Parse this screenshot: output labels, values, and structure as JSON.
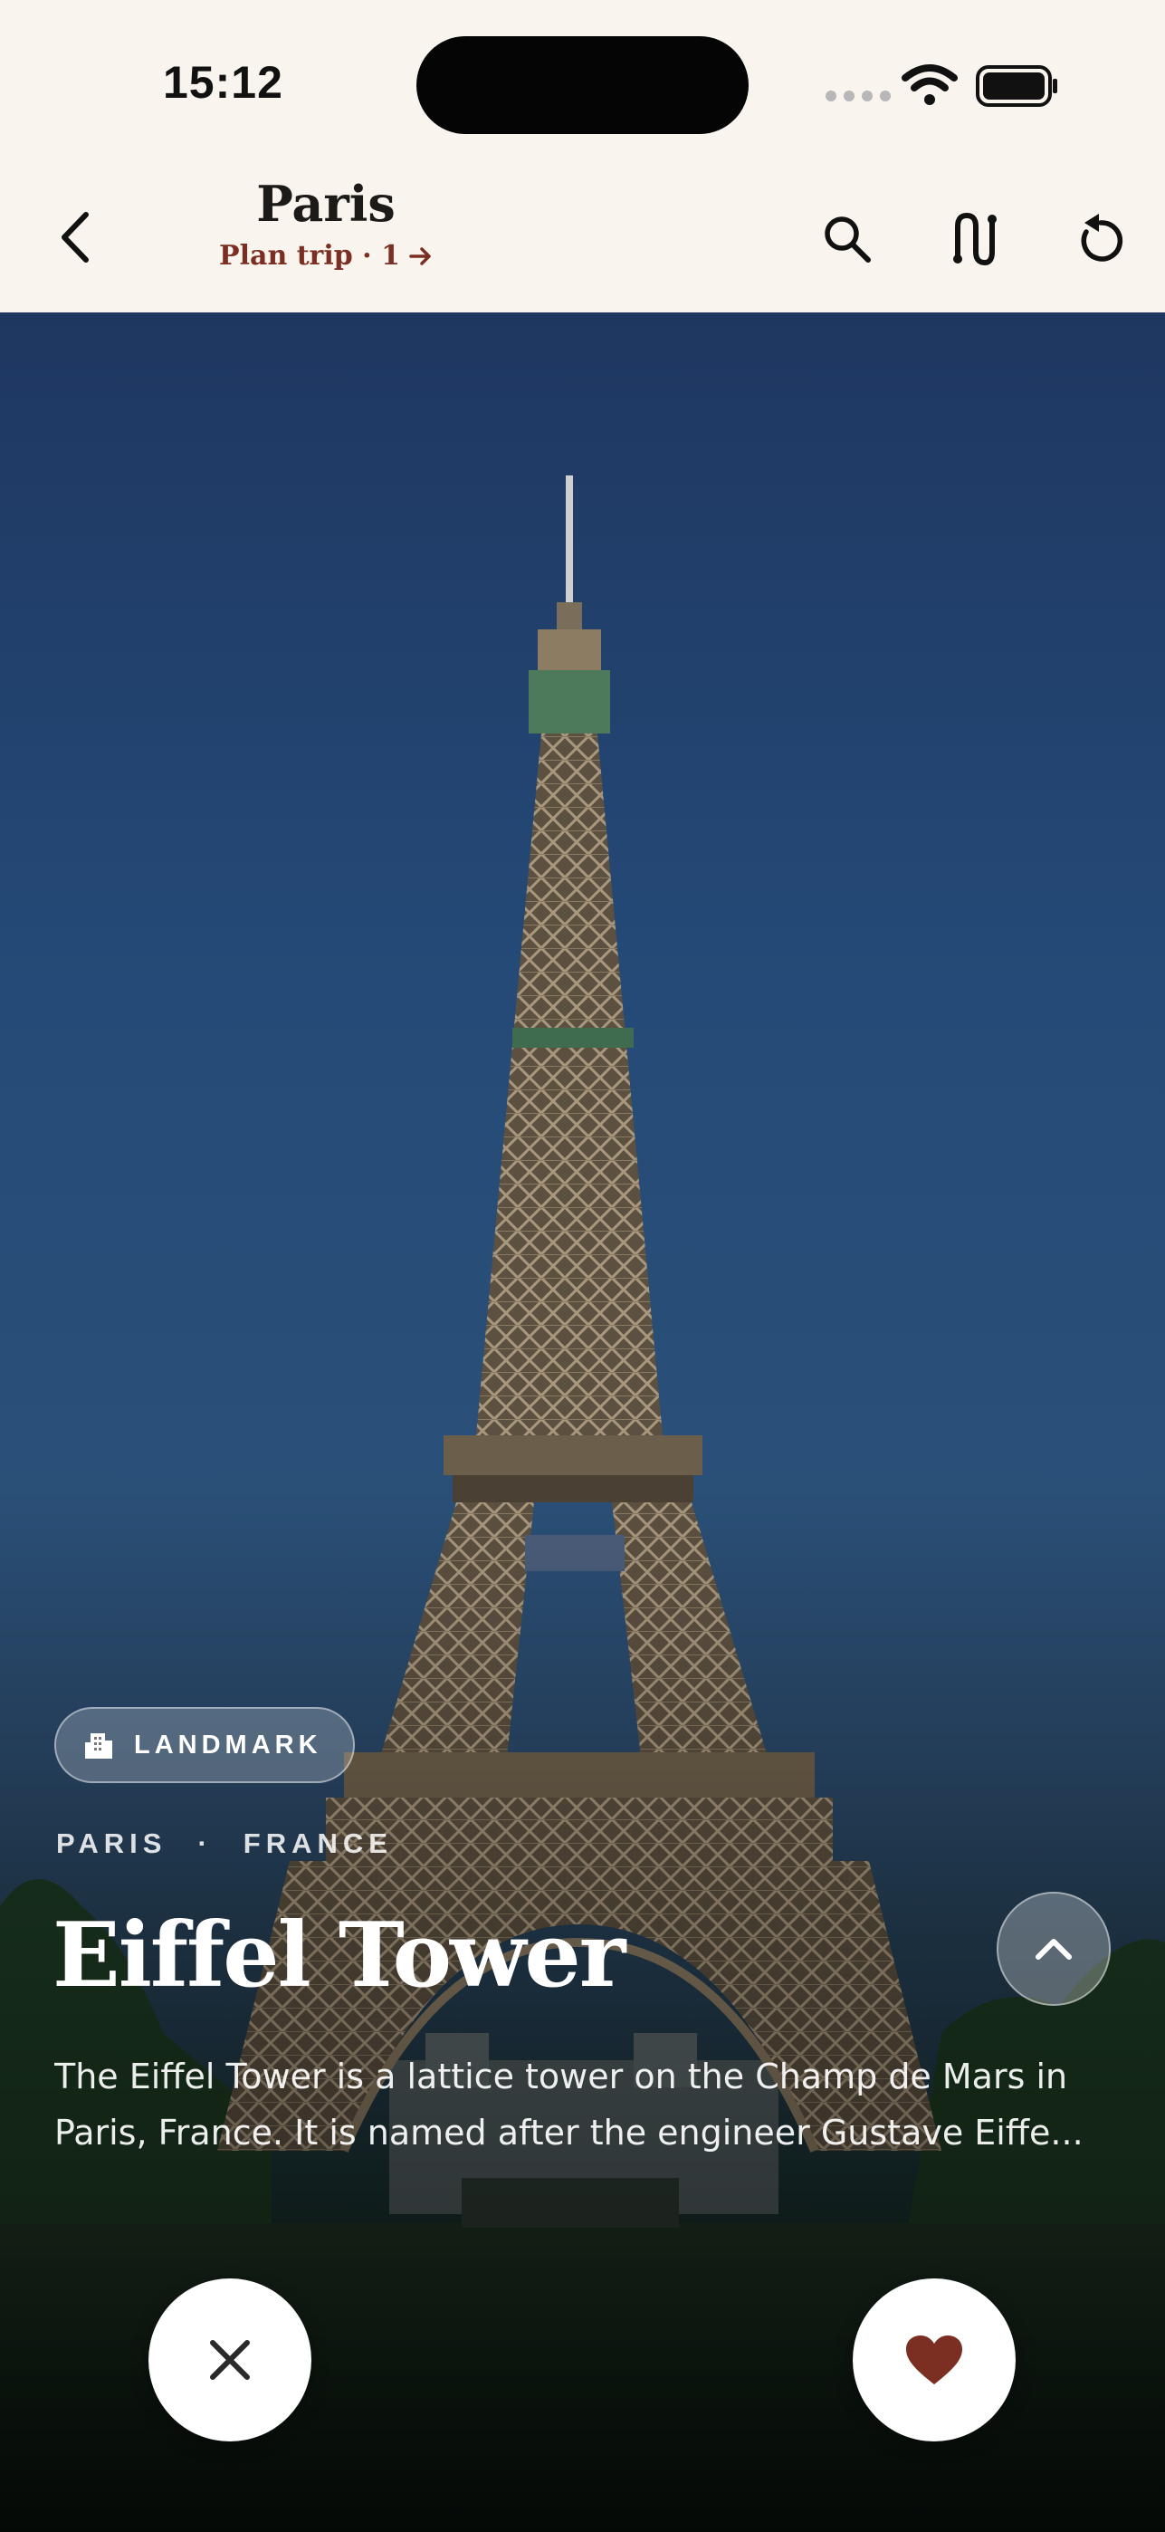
{
  "status_bar": {
    "time": "15:12"
  },
  "header": {
    "title": "Paris",
    "plan_trip": "Plan trip · 1",
    "icons": [
      "back-chevron-icon",
      "search-icon",
      "route-icon",
      "undo-icon"
    ]
  },
  "card": {
    "category": "LANDMARK",
    "city": "PARIS",
    "separator": "·",
    "country": "FRANCE",
    "name": "Eiffel Tower",
    "description_line1": "The Eiffel Tower is a lattice tower on the Champ de Mars in",
    "description_line2": "Paris, France. It is named after the engineer Gustave Eiffe..."
  },
  "actions": [
    "dismiss-icon",
    "heart-icon",
    "chevron-up-icon"
  ],
  "colors": {
    "accent": "#7b2e22",
    "header_bg": "#f9f5ee",
    "sky": "#254a77"
  }
}
